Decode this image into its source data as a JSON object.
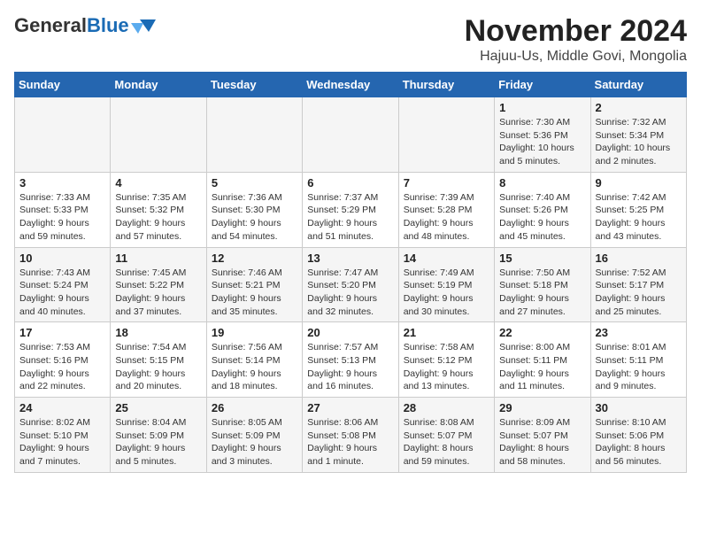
{
  "header": {
    "logo_general": "General",
    "logo_blue": "Blue",
    "month_title": "November 2024",
    "subtitle": "Hajuu-Us, Middle Govi, Mongolia"
  },
  "weekdays": [
    "Sunday",
    "Monday",
    "Tuesday",
    "Wednesday",
    "Thursday",
    "Friday",
    "Saturday"
  ],
  "weeks": [
    [
      {
        "day": "",
        "info": ""
      },
      {
        "day": "",
        "info": ""
      },
      {
        "day": "",
        "info": ""
      },
      {
        "day": "",
        "info": ""
      },
      {
        "day": "",
        "info": ""
      },
      {
        "day": "1",
        "info": "Sunrise: 7:30 AM\nSunset: 5:36 PM\nDaylight: 10 hours\nand 5 minutes."
      },
      {
        "day": "2",
        "info": "Sunrise: 7:32 AM\nSunset: 5:34 PM\nDaylight: 10 hours\nand 2 minutes."
      }
    ],
    [
      {
        "day": "3",
        "info": "Sunrise: 7:33 AM\nSunset: 5:33 PM\nDaylight: 9 hours\nand 59 minutes."
      },
      {
        "day": "4",
        "info": "Sunrise: 7:35 AM\nSunset: 5:32 PM\nDaylight: 9 hours\nand 57 minutes."
      },
      {
        "day": "5",
        "info": "Sunrise: 7:36 AM\nSunset: 5:30 PM\nDaylight: 9 hours\nand 54 minutes."
      },
      {
        "day": "6",
        "info": "Sunrise: 7:37 AM\nSunset: 5:29 PM\nDaylight: 9 hours\nand 51 minutes."
      },
      {
        "day": "7",
        "info": "Sunrise: 7:39 AM\nSunset: 5:28 PM\nDaylight: 9 hours\nand 48 minutes."
      },
      {
        "day": "8",
        "info": "Sunrise: 7:40 AM\nSunset: 5:26 PM\nDaylight: 9 hours\nand 45 minutes."
      },
      {
        "day": "9",
        "info": "Sunrise: 7:42 AM\nSunset: 5:25 PM\nDaylight: 9 hours\nand 43 minutes."
      }
    ],
    [
      {
        "day": "10",
        "info": "Sunrise: 7:43 AM\nSunset: 5:24 PM\nDaylight: 9 hours\nand 40 minutes."
      },
      {
        "day": "11",
        "info": "Sunrise: 7:45 AM\nSunset: 5:22 PM\nDaylight: 9 hours\nand 37 minutes."
      },
      {
        "day": "12",
        "info": "Sunrise: 7:46 AM\nSunset: 5:21 PM\nDaylight: 9 hours\nand 35 minutes."
      },
      {
        "day": "13",
        "info": "Sunrise: 7:47 AM\nSunset: 5:20 PM\nDaylight: 9 hours\nand 32 minutes."
      },
      {
        "day": "14",
        "info": "Sunrise: 7:49 AM\nSunset: 5:19 PM\nDaylight: 9 hours\nand 30 minutes."
      },
      {
        "day": "15",
        "info": "Sunrise: 7:50 AM\nSunset: 5:18 PM\nDaylight: 9 hours\nand 27 minutes."
      },
      {
        "day": "16",
        "info": "Sunrise: 7:52 AM\nSunset: 5:17 PM\nDaylight: 9 hours\nand 25 minutes."
      }
    ],
    [
      {
        "day": "17",
        "info": "Sunrise: 7:53 AM\nSunset: 5:16 PM\nDaylight: 9 hours\nand 22 minutes."
      },
      {
        "day": "18",
        "info": "Sunrise: 7:54 AM\nSunset: 5:15 PM\nDaylight: 9 hours\nand 20 minutes."
      },
      {
        "day": "19",
        "info": "Sunrise: 7:56 AM\nSunset: 5:14 PM\nDaylight: 9 hours\nand 18 minutes."
      },
      {
        "day": "20",
        "info": "Sunrise: 7:57 AM\nSunset: 5:13 PM\nDaylight: 9 hours\nand 16 minutes."
      },
      {
        "day": "21",
        "info": "Sunrise: 7:58 AM\nSunset: 5:12 PM\nDaylight: 9 hours\nand 13 minutes."
      },
      {
        "day": "22",
        "info": "Sunrise: 8:00 AM\nSunset: 5:11 PM\nDaylight: 9 hours\nand 11 minutes."
      },
      {
        "day": "23",
        "info": "Sunrise: 8:01 AM\nSunset: 5:11 PM\nDaylight: 9 hours\nand 9 minutes."
      }
    ],
    [
      {
        "day": "24",
        "info": "Sunrise: 8:02 AM\nSunset: 5:10 PM\nDaylight: 9 hours\nand 7 minutes."
      },
      {
        "day": "25",
        "info": "Sunrise: 8:04 AM\nSunset: 5:09 PM\nDaylight: 9 hours\nand 5 minutes."
      },
      {
        "day": "26",
        "info": "Sunrise: 8:05 AM\nSunset: 5:09 PM\nDaylight: 9 hours\nand 3 minutes."
      },
      {
        "day": "27",
        "info": "Sunrise: 8:06 AM\nSunset: 5:08 PM\nDaylight: 9 hours\nand 1 minute."
      },
      {
        "day": "28",
        "info": "Sunrise: 8:08 AM\nSunset: 5:07 PM\nDaylight: 8 hours\nand 59 minutes."
      },
      {
        "day": "29",
        "info": "Sunrise: 8:09 AM\nSunset: 5:07 PM\nDaylight: 8 hours\nand 58 minutes."
      },
      {
        "day": "30",
        "info": "Sunrise: 8:10 AM\nSunset: 5:06 PM\nDaylight: 8 hours\nand 56 minutes."
      }
    ]
  ]
}
